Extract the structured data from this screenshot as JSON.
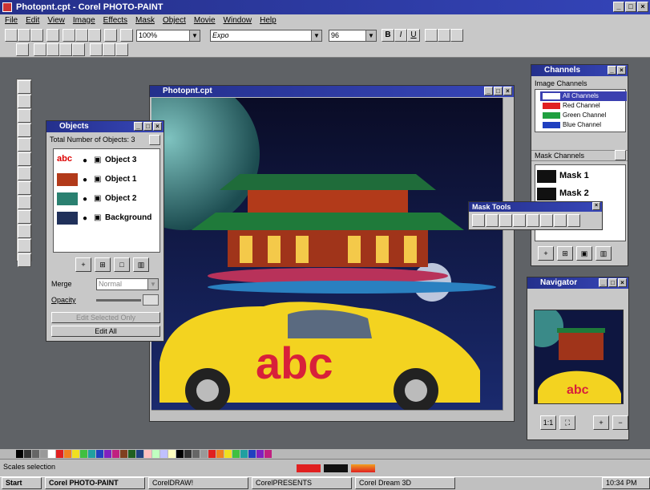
{
  "window": {
    "title": "Photopnt.cpt - Corel PHOTO-PAINT",
    "min": "_",
    "max": "□",
    "close": "×"
  },
  "menu": [
    "File",
    "Edit",
    "View",
    "Image",
    "Effects",
    "Mask",
    "Object",
    "Movie",
    "Window",
    "Help"
  ],
  "toolbar": {
    "zoom_value": "100%",
    "font_value": "Expo",
    "size_value": "96",
    "bold": "B",
    "italic": "I",
    "underline": "U"
  },
  "canvas_window": {
    "title": "Photopnt.cpt"
  },
  "canvas_image": {
    "text_overlay": "abc"
  },
  "objects_panel": {
    "title": "Objects",
    "total_label": "Total Number of Objects: 3",
    "rows": [
      {
        "label": "Object 3"
      },
      {
        "label": "Object 1"
      },
      {
        "label": "Object 2"
      },
      {
        "label": "Background"
      }
    ],
    "merge_label": "Merge",
    "merge_value": "Normal",
    "opacity_label": "Opacity",
    "edit_selected_label": "Edit Selected Only",
    "edit_all_label": "Edit All"
  },
  "channels_panel": {
    "title": "Channels",
    "image_channels_label": "Image Channels",
    "channels": [
      {
        "label": "All Channels",
        "color": "#ffffff"
      },
      {
        "label": "Red Channel",
        "color": "#e02020"
      },
      {
        "label": "Green Channel",
        "color": "#20a040"
      },
      {
        "label": "Blue Channel",
        "color": "#2040c0"
      }
    ],
    "mask_channels_label": "Mask Channels",
    "masks": [
      {
        "label": "Mask 1"
      },
      {
        "label": "Mask 2"
      }
    ]
  },
  "mask_tools": {
    "title": "Mask Tools"
  },
  "navigator": {
    "title": "Navigator",
    "nav_text": "abc"
  },
  "status": {
    "text": "Scales selection",
    "time": "10:34 PM"
  },
  "taskbar": {
    "start": "Start",
    "tasks": [
      "Corel PHOTO-PAINT",
      "CorelDRAW!",
      "CorelPRESENTS",
      "Corel Dream 3D"
    ]
  },
  "colors": {
    "accent": "#25308a",
    "body": "#c8c8c8"
  }
}
